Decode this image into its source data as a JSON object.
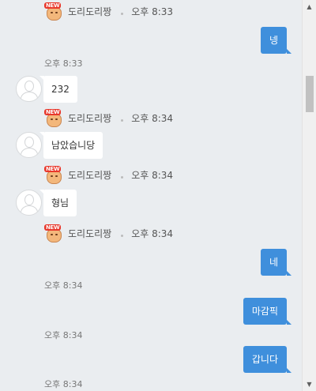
{
  "sender_name": "도리도리짱",
  "badge_text": "NEW",
  "messages": {
    "top_name_time": "오후 8:33",
    "out1": {
      "text": "넹",
      "time": "오후 8:33"
    },
    "in1": {
      "text": "232"
    },
    "name2_time": "오후 8:34",
    "in2": {
      "text": "남았습니당"
    },
    "name3_time": "오후 8:34",
    "in3": {
      "text": "형님"
    },
    "name4_time": "오후 8:34",
    "out2": {
      "text": "네",
      "time": "오후 8:34"
    },
    "out3": {
      "text": "마감픽",
      "time": "오후 8:34"
    },
    "out4": {
      "text": "갑니다",
      "time": "오후 8:34"
    }
  },
  "scrollbar": {
    "up_arrow": "▲",
    "down_arrow": "▼"
  }
}
